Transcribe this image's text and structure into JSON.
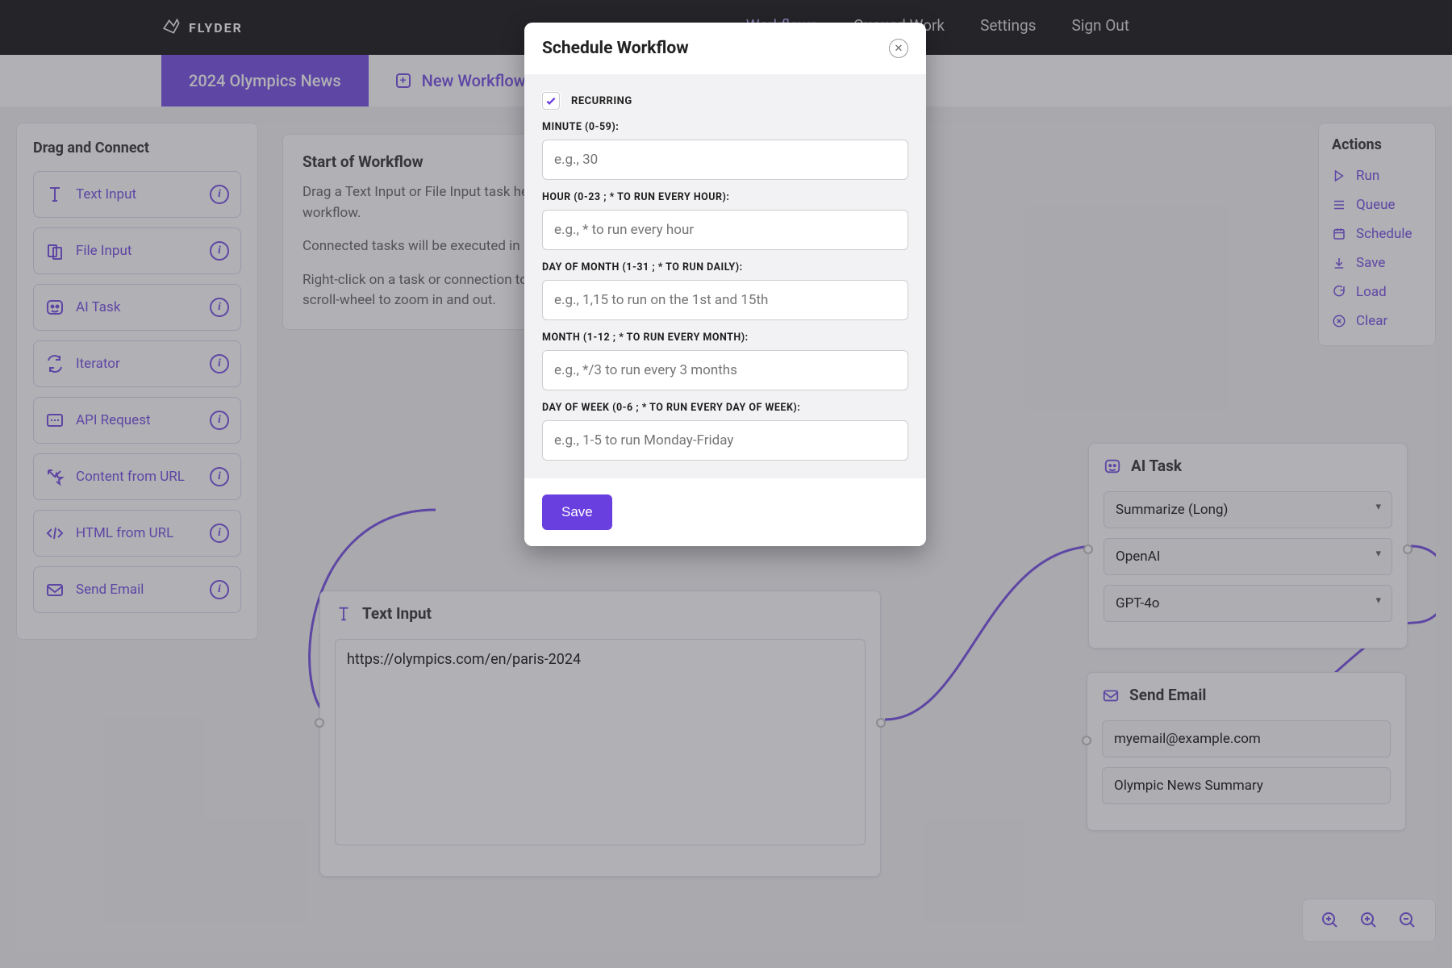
{
  "brand": "FLYDER",
  "nav": {
    "items": [
      "Workflows",
      "Queued Work",
      "Settings",
      "Sign Out"
    ],
    "active_index": 0
  },
  "tabs": {
    "active": "2024 Olympics News",
    "new": "New Workflow"
  },
  "toolbox": {
    "heading": "Drag and Connect",
    "items": [
      {
        "id": "text-input",
        "label": "Text Input"
      },
      {
        "id": "file-input",
        "label": "File Input"
      },
      {
        "id": "ai-task",
        "label": "AI Task"
      },
      {
        "id": "iterator",
        "label": "Iterator"
      },
      {
        "id": "api-request",
        "label": "API Request"
      },
      {
        "id": "content-from-url",
        "label": "Content from URL"
      },
      {
        "id": "html-from-url",
        "label": "HTML from URL"
      },
      {
        "id": "send-email",
        "label": "Send Email"
      }
    ]
  },
  "instructions": {
    "heading": "Start of Workflow",
    "p1": "Drag a Text Input or File Input task here to begin your workflow.",
    "p2": "Connected tasks will be executed in sequence.",
    "p3": "Right-click on a task or connection to delete it. CTRL + scroll-wheel to zoom in and out."
  },
  "actions": {
    "heading": "Actions",
    "items": [
      "Run",
      "Queue",
      "Schedule",
      "Save",
      "Load",
      "Clear"
    ]
  },
  "nodes": {
    "text_input": {
      "title": "Text Input",
      "value": "https://olympics.com/en/paris-2024"
    },
    "ai_task": {
      "title": "AI Task",
      "select1": "Summarize (Long)",
      "select2": "OpenAI",
      "select3": "GPT-4o"
    },
    "send_email": {
      "title": "Send Email",
      "to": "myemail@example.com",
      "subject": "Olympic News Summary"
    }
  },
  "modal": {
    "title": "Schedule Workflow",
    "recurring_label": "Recurring",
    "fields": {
      "minute": {
        "label": "Minute (0-59):",
        "placeholder": "e.g., 30"
      },
      "hour": {
        "label": "Hour (0-23 ; * to run every hour):",
        "placeholder": "e.g., * to run every hour"
      },
      "dom": {
        "label": "Day of Month (1-31 ; * to run daily):",
        "placeholder": "e.g., 1,15 to run on the 1st and 15th"
      },
      "month": {
        "label": "Month (1-12 ; * to run every month):",
        "placeholder": "e.g., */3 to run every 3 months"
      },
      "dow": {
        "label": "Day of Week (0-6 ; * to run every day of week):",
        "placeholder": "e.g., 1-5 to run Monday-Friday"
      }
    },
    "save": "Save"
  }
}
